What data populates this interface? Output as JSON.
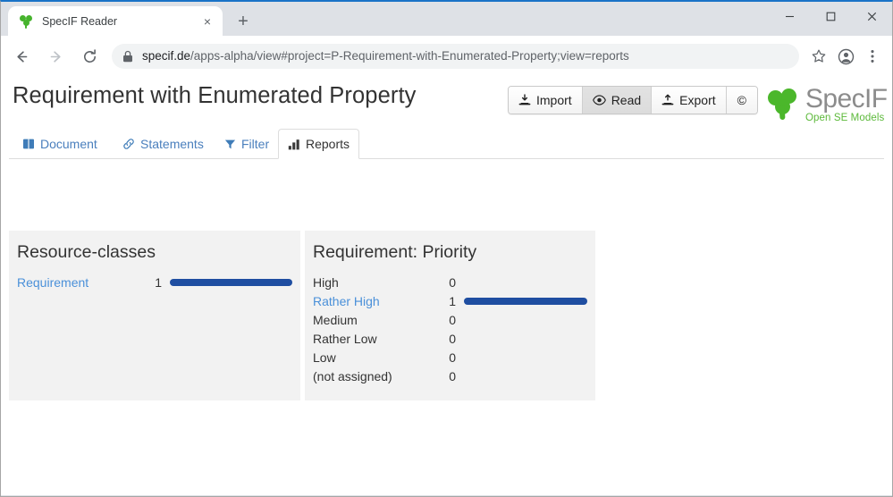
{
  "browser": {
    "tab": {
      "title": "SpecIF Reader",
      "favicon": "clover-icon",
      "close_label": "×"
    },
    "new_tab_label": "+",
    "window_controls": {
      "minimize": "minimize-icon",
      "maximize": "maximize-icon",
      "close": "close-icon"
    },
    "nav": {
      "back": "back-arrow-icon",
      "forward": "forward-arrow-icon",
      "reload": "reload-icon"
    },
    "omnibox": {
      "lock": "lock-icon",
      "host": "specif.de",
      "path": "/apps-alpha/view#project=P-Requirement-with-Enumerated-Property;view=reports",
      "full_url": "specif.de/apps-alpha/view#project=P-Requirement-with-Enumerated-Property;view=reports"
    },
    "actions": {
      "bookmark": "star-icon",
      "profile": "account-avatar-icon",
      "menu": "three-dot-menu-icon"
    }
  },
  "app": {
    "page_title": "Requirement with Enumerated Property",
    "toolbar": [
      {
        "id": "import",
        "label": "Import",
        "icon": "import-tray-icon",
        "active": false
      },
      {
        "id": "read",
        "label": "Read",
        "icon": "eye-icon",
        "active": true
      },
      {
        "id": "export",
        "label": "Export",
        "icon": "export-tray-icon",
        "active": false
      },
      {
        "id": "copyright",
        "label": "©",
        "icon": "copyright-icon",
        "active": false
      }
    ],
    "logo": {
      "name": "SpecIF",
      "tagline": "Open SE Models",
      "mark": "clover-icon"
    },
    "tabs": [
      {
        "id": "document",
        "label": "Document",
        "icon": "book-icon",
        "active": false
      },
      {
        "id": "statements",
        "label": "Statements",
        "icon": "link-icon",
        "active": false
      },
      {
        "id": "filter",
        "label": "Filter",
        "icon": "funnel-icon",
        "active": false
      },
      {
        "id": "reports",
        "label": "Reports",
        "icon": "bar-chart-icon",
        "active": true
      }
    ]
  },
  "chart_data": [
    {
      "type": "bar",
      "title": "Resource-classes",
      "orientation": "horizontal",
      "categories": [
        "Requirement"
      ],
      "values": [
        1
      ],
      "xlim": [
        0,
        1
      ],
      "grid": false,
      "legend": false,
      "bar_color": "#1f4ea1",
      "link_categories": [
        "Requirement"
      ]
    },
    {
      "type": "bar",
      "title": "Requirement: Priority",
      "orientation": "horizontal",
      "categories": [
        "High",
        "Rather High",
        "Medium",
        "Rather Low",
        "Low",
        "(not assigned)"
      ],
      "values": [
        0,
        1,
        0,
        0,
        0,
        0
      ],
      "xlim": [
        0,
        1
      ],
      "grid": false,
      "legend": false,
      "bar_color": "#1f4ea1",
      "link_categories": [
        "Rather High"
      ]
    }
  ],
  "colors": {
    "accent_blue": "#1f4ea1",
    "link_blue": "#4a90d9",
    "tab_blue": "#4a7fbd",
    "panel_bg": "#f2f2f2",
    "brand_green": "#4bb72b",
    "chrome_bg": "#dee1e6"
  }
}
